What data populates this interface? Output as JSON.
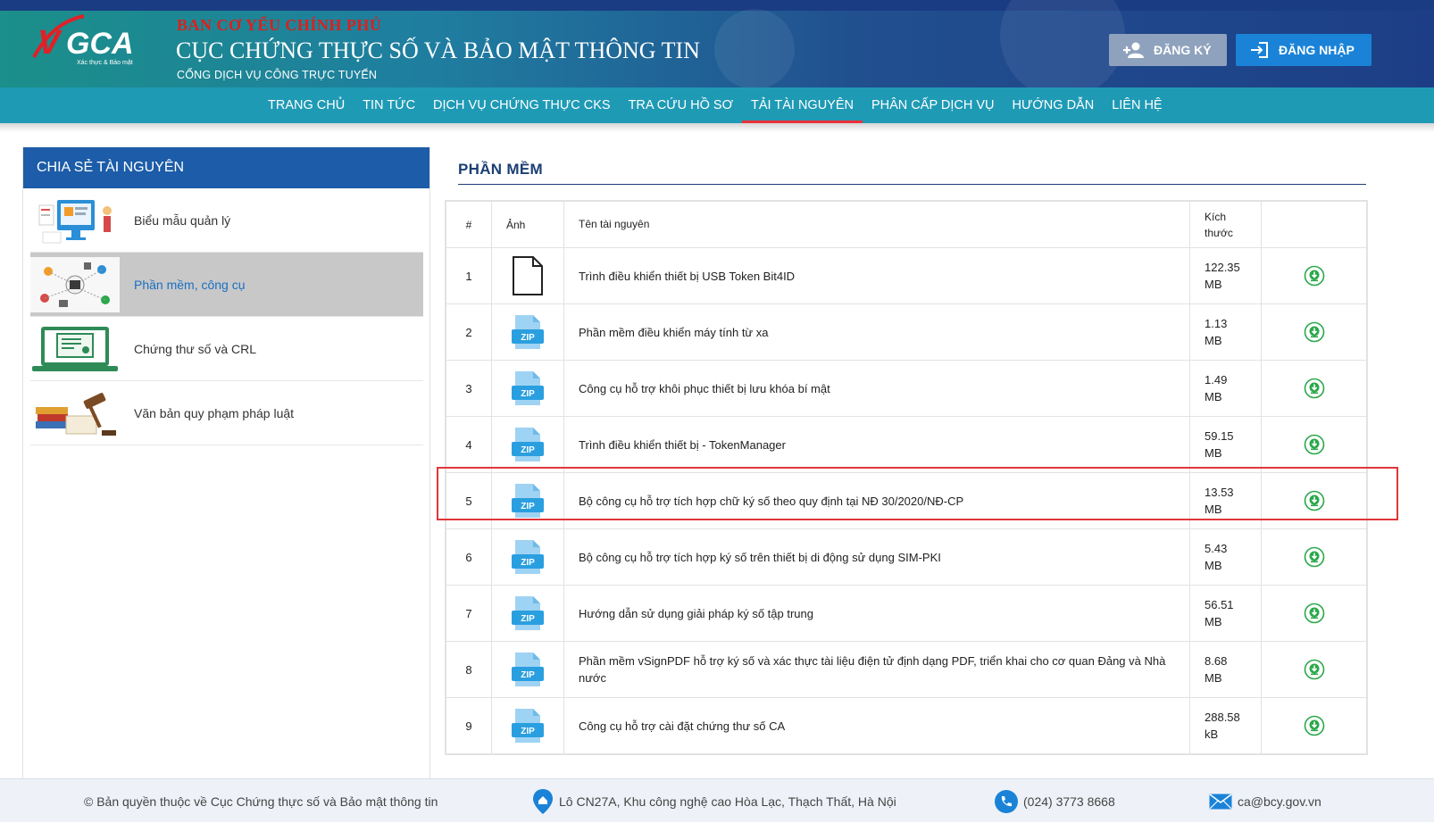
{
  "header": {
    "org_top": "BAN CƠ YẾU CHÍNH PHỦ",
    "org_main": "CỤC CHỨNG THỰC SỐ VÀ BẢO MẬT THÔNG TIN",
    "org_sub": "CỔNG DỊCH VỤ CÔNG TRỰC TUYẾN",
    "register_label": "ĐĂNG KÝ",
    "login_label": "ĐĂNG NHẬP",
    "logo_text": "VGCA",
    "logo_tagline": "Xác thực & Bảo mật"
  },
  "nav": {
    "items": [
      {
        "label": "TRANG CHỦ"
      },
      {
        "label": "TIN TỨC"
      },
      {
        "label": "DỊCH VỤ CHỨNG THỰC CKS"
      },
      {
        "label": "TRA CỨU HỒ SƠ"
      },
      {
        "label": "TẢI TÀI NGUYÊN"
      },
      {
        "label": "PHÂN CẤP DỊCH VỤ"
      },
      {
        "label": "HƯỚNG DẪN"
      },
      {
        "label": "LIÊN HỆ"
      }
    ],
    "active_index": 4,
    "active_color": "#e8323a"
  },
  "sidebar": {
    "title": "CHIA SẺ TÀI NGUYÊN",
    "items": [
      {
        "label": "Biểu mẫu quản lý",
        "icon": "forms-illustration-icon"
      },
      {
        "label": "Phần mềm, công cụ",
        "icon": "software-tools-illustration-icon",
        "active": true
      },
      {
        "label": "Chứng thư số và CRL",
        "icon": "certificate-laptop-icon"
      },
      {
        "label": "Văn bản quy phạm pháp luật",
        "icon": "law-books-gavel-icon"
      }
    ]
  },
  "main": {
    "section_title": "PHẦN MỀM",
    "columns": {
      "num": "#",
      "image": "Ảnh",
      "name": "Tên tài nguyên",
      "size": "Kích thước"
    },
    "rows": [
      {
        "num": "1",
        "type": "file",
        "name": "Trình điều khiển thiết bị USB Token Bit4ID",
        "size": "122.35 MB"
      },
      {
        "num": "2",
        "type": "zip",
        "name": "Phần mềm điều khiển máy tính từ xa",
        "size": "1.13 MB"
      },
      {
        "num": "3",
        "type": "zip",
        "name": "Công cụ hỗ trợ khôi phục thiết bị lưu khóa bí mật",
        "size": "1.49 MB"
      },
      {
        "num": "4",
        "type": "zip",
        "name": "Trình điều khiển thiết bị - TokenManager",
        "size": "59.15 MB"
      },
      {
        "num": "5",
        "type": "zip",
        "name": "Bộ công cụ hỗ trợ tích hợp chữ ký số theo quy định tại NĐ 30/2020/NĐ-CP",
        "size": "13.53 MB",
        "highlighted": true
      },
      {
        "num": "6",
        "type": "zip",
        "name": "Bộ công cụ hỗ trợ tích hợp ký số trên thiết bị di động sử dụng SIM-PKI",
        "size": "5.43 MB"
      },
      {
        "num": "7",
        "type": "zip",
        "name": "Hướng dẫn sử dụng giải pháp ký số tập trung",
        "size": "56.51 MB"
      },
      {
        "num": "8",
        "type": "zip",
        "name": "Phần mềm vSignPDF hỗ trợ ký số và xác thực tài liệu điện tử định dạng PDF, triển khai cho cơ quan Đảng và Nhà nước",
        "size": "8.68 MB"
      },
      {
        "num": "9",
        "type": "zip",
        "name": "Công cụ hỗ trợ cài đặt chứng thư số CA",
        "size": "288.58 kB"
      }
    ],
    "zip_label": "ZIP",
    "highlight_color": "#e0363a",
    "download_color": "#2aa84a"
  },
  "footer": {
    "copyright": "© Bản quyền thuộc về Cục Chứng thực số và Bảo mật thông tin",
    "address": "Lô CN27A, Khu công nghệ cao Hòa Lạc, Thạch Thất, Hà Nội",
    "phone": "(024) 3773 8668",
    "email": "ca@bcy.gov.vn"
  }
}
